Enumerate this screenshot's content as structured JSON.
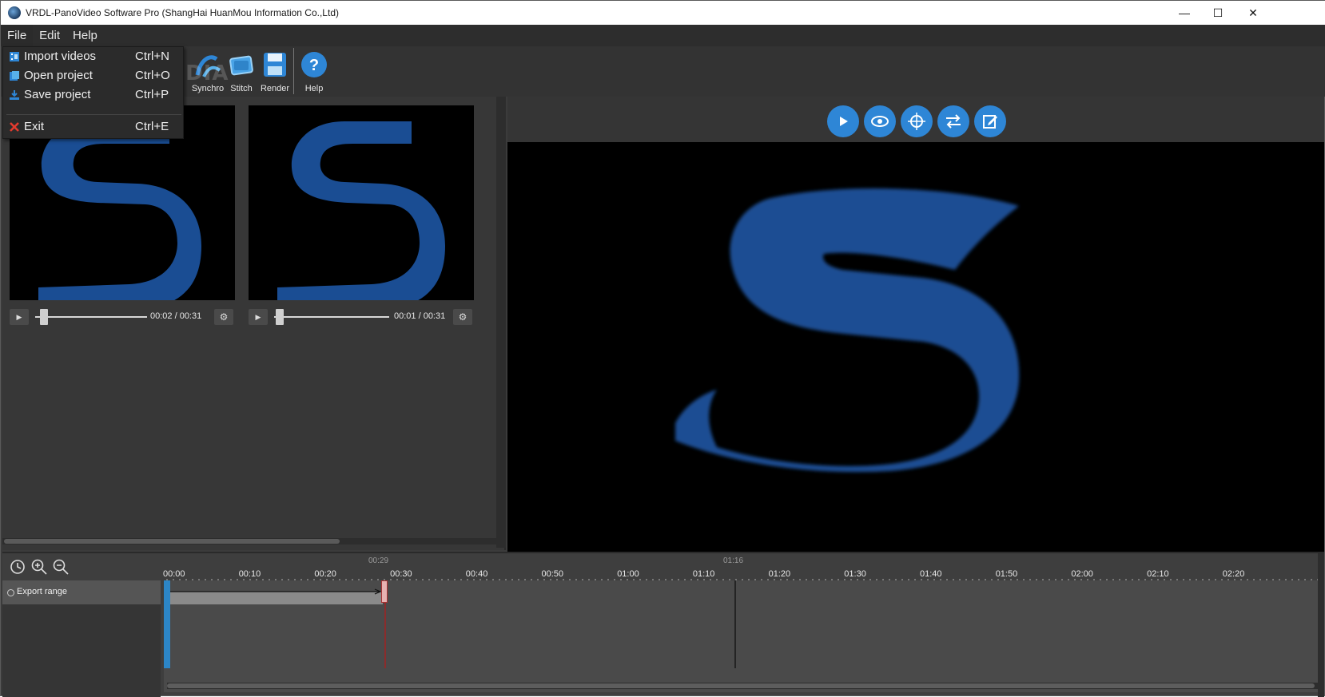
{
  "window": {
    "title": "VRDL-PanoVideo Software Pro (ShangHai HuanMou Information Co.,Ltd)",
    "controls": {
      "minimize": "—",
      "maximize": "☐",
      "close": "✕"
    }
  },
  "menubar": {
    "items": [
      {
        "label": "File"
      },
      {
        "label": "Edit"
      },
      {
        "label": "Help"
      }
    ]
  },
  "file_menu": {
    "items": [
      {
        "label": "Import videos",
        "shortcut": "Ctrl+N",
        "icon": "film-icon"
      },
      {
        "label": "Open project",
        "shortcut": "Ctrl+O",
        "icon": "folder-icon"
      },
      {
        "label": "Save project",
        "shortcut": "Ctrl+P",
        "icon": "download-icon"
      },
      {
        "label": "Exit",
        "shortcut": "Ctrl+E",
        "icon": "close-icon"
      }
    ]
  },
  "toolbar": {
    "buttons": [
      {
        "label": "Synchro",
        "icon": "synchro-icon"
      },
      {
        "label": "Stitch",
        "icon": "stitch-icon"
      },
      {
        "label": "Render",
        "icon": "save-disk-icon"
      },
      {
        "label": "Help",
        "icon": "question-icon"
      }
    ]
  },
  "videos": [
    {
      "time": "00:02 / 00:31",
      "progress": 0.065
    },
    {
      "time": "00:01 / 00:31",
      "progress": 0.032
    }
  ],
  "preview_toolbar": {
    "buttons": [
      {
        "name": "play",
        "icon": "play-icon"
      },
      {
        "name": "view",
        "icon": "eye-icon"
      },
      {
        "name": "navigate",
        "icon": "compass-icon"
      },
      {
        "name": "swap",
        "icon": "swap-arrows-icon"
      },
      {
        "name": "edit",
        "icon": "edit-icon"
      }
    ]
  },
  "timeline": {
    "track_name": "Export range",
    "ticks": [
      "00:00",
      "00:10",
      "00:20",
      "00:30",
      "00:40",
      "00:50",
      "01:00",
      "01:10",
      "01:20",
      "01:30",
      "01:40",
      "01:50",
      "02:00",
      "02:10",
      "02:20"
    ],
    "end_marker_label": "00:29",
    "cursor_label": "01:16",
    "range_start": "00:00",
    "range_end": "00:29"
  },
  "watermark": "SOFTPEDIA",
  "colors": {
    "accent": "#2e86d6",
    "logo_blue": "#1a4d93",
    "range_start": "#2c86c7",
    "range_end": "#8a2c2c"
  }
}
